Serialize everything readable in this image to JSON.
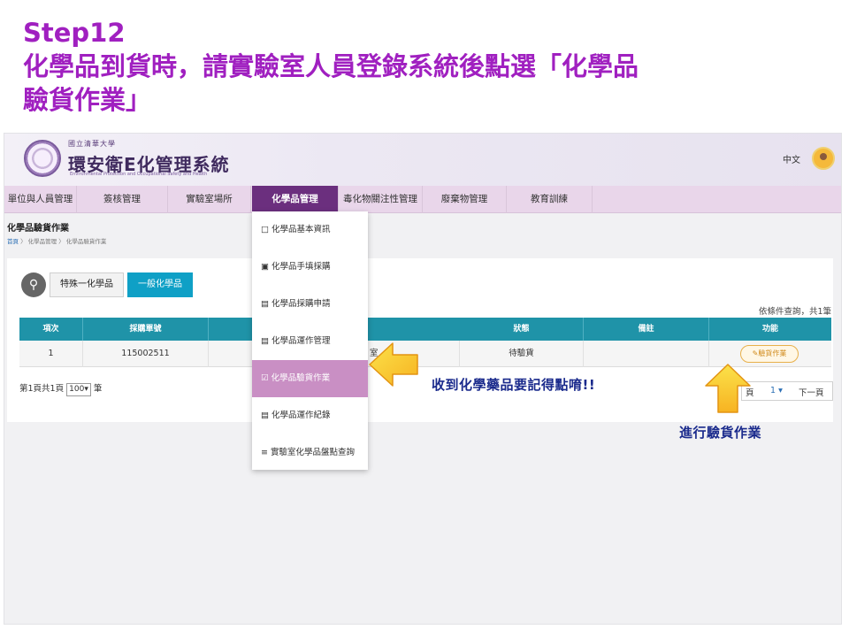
{
  "slide": {
    "step": "Step12",
    "instruction_line1": "化學品到貨時，請實驗室人員登錄系統後點選「化學品",
    "instruction_line2": "驗貨作業」"
  },
  "header": {
    "school": "國立清華大學",
    "system_name": "環安衛E化管理系統",
    "subtitle": "Environmental Protection and Occupational Safety and Health",
    "language": "中文",
    "avatar_icon": "user-avatar-icon"
  },
  "nav": {
    "items": [
      {
        "label": "單位與人員管理"
      },
      {
        "label": "簽核管理"
      },
      {
        "label": "實驗室場所"
      },
      {
        "label": "化學品管理"
      },
      {
        "label": "毒化物關注性管理"
      },
      {
        "label": "廢棄物管理"
      },
      {
        "label": "教育訓練"
      }
    ],
    "active_index": 3
  },
  "page": {
    "title": "化學品驗貨作業",
    "breadcrumb": [
      "首頁",
      "化學品管理",
      "化學品驗貨作業"
    ]
  },
  "filters": {
    "search_icon": "search-icon",
    "tab_special": "特殊一化學品",
    "tab_general": "一般化學品",
    "query_info": "依條件查詢，共1筆"
  },
  "table": {
    "headers": [
      "項次",
      "採購單號",
      "",
      "",
      "狀態",
      "備註",
      "功能"
    ],
    "rows": [
      {
        "index": "1",
        "order_no": "115002511",
        "room": "室",
        "status": "待驗貨",
        "note": "",
        "action": "✎驗貨作業"
      }
    ]
  },
  "pager": {
    "summary_prefix": "第1頁共1頁",
    "page_size": "100",
    "summary_suffix": "筆",
    "page_label": "頁",
    "page_number": "1",
    "next": "下一頁"
  },
  "dropdown": {
    "items": [
      {
        "icon": "□",
        "label": "化學品基本資訊"
      },
      {
        "icon": "▣",
        "label": "化學品手填採購"
      },
      {
        "icon": "▤",
        "label": "化學品採購申請"
      },
      {
        "icon": "▤",
        "label": "化學品運作管理"
      },
      {
        "icon": "☑",
        "label": "化學品驗貨作業"
      },
      {
        "icon": "▤",
        "label": "化學品運作紀錄"
      },
      {
        "icon": "≡",
        "label": "實驗室化學品盤點查詢"
      }
    ],
    "selected_index": 4
  },
  "annotations": {
    "callout_menu": "收到化學藥品要記得點唷!!",
    "callout_action": "進行驗貨作業",
    "arrow_color": "#f4a020"
  }
}
